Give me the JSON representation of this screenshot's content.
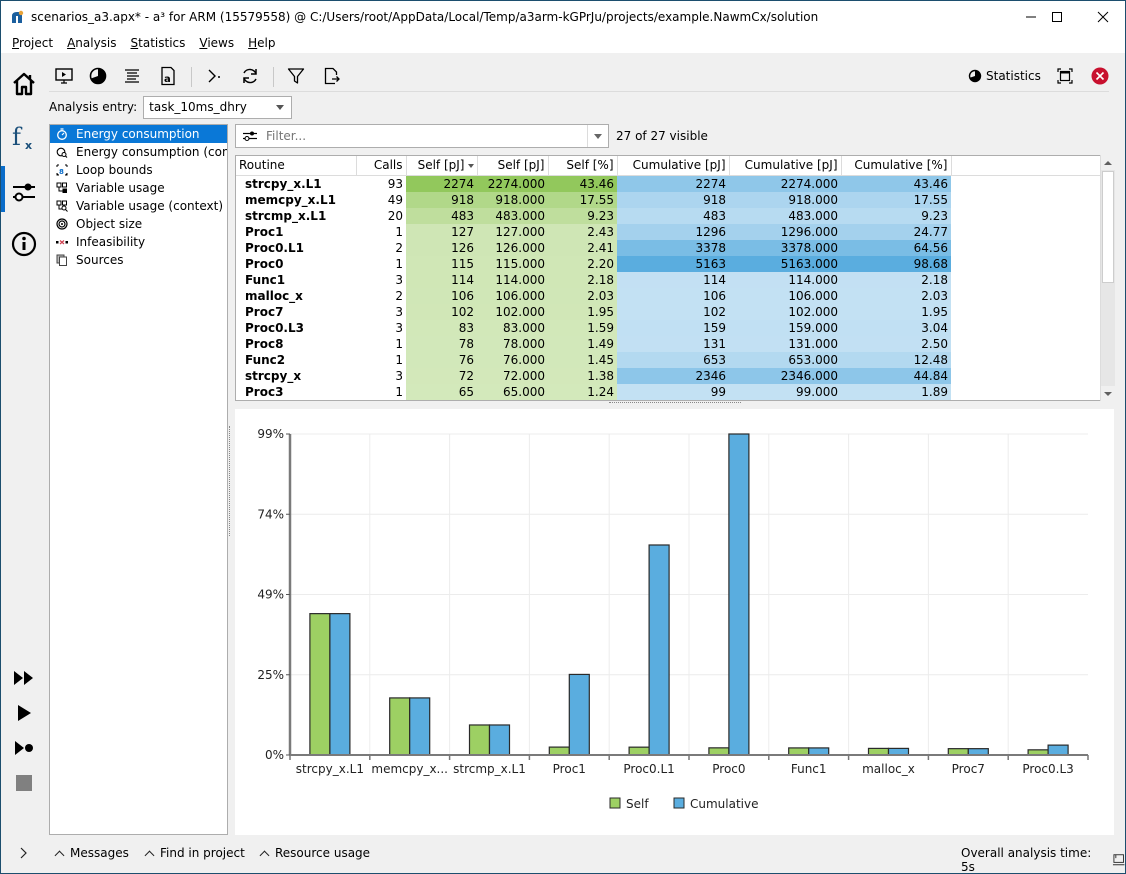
{
  "window": {
    "title": "scenarios_a3.apx* - a³ for ARM (15579558) @ C:/Users/root/AppData/Local/Temp/a3arm-kGPrJu/projects/example.NawmCx/solution",
    "controls": [
      "minimize",
      "maximize",
      "close"
    ]
  },
  "menu": [
    {
      "label": "Project",
      "accel": "P"
    },
    {
      "label": "Analysis",
      "accel": "A"
    },
    {
      "label": "Statistics",
      "accel": "S"
    },
    {
      "label": "Views",
      "accel": "V"
    },
    {
      "label": "Help",
      "accel": "H"
    }
  ],
  "left_rail": {
    "top_icons": [
      "home-icon",
      "function-icon",
      "settings-slider-icon",
      "info-icon"
    ],
    "active": "function-icon",
    "bottom_icons": [
      "run-all-icon",
      "run-icon",
      "run-to-breakpoint-icon",
      "stop-icon"
    ]
  },
  "toolbar": {
    "buttons": [
      "presentation-icon",
      "pie-chart-icon",
      "text-align-icon",
      "text-file-icon",
      "step-icon",
      "refresh-icon",
      "filter-icon",
      "export-icon"
    ],
    "statistics_label": "Statistics"
  },
  "analysis_entry": {
    "label": "Analysis entry:",
    "value": "task_10ms_dhry"
  },
  "nav": {
    "items": [
      {
        "label": "Energy consumption",
        "icon": "stopwatch-icon",
        "selected": true
      },
      {
        "label": "Energy consumption (con...",
        "icon": "stopwatch-search-icon",
        "selected": false
      },
      {
        "label": "Loop bounds",
        "icon": "loop-bounds-icon",
        "selected": false
      },
      {
        "label": "Variable usage",
        "icon": "variable-usage-icon",
        "selected": false
      },
      {
        "label": "Variable usage (context)",
        "icon": "variable-usage-context-icon",
        "selected": false
      },
      {
        "label": "Object size",
        "icon": "object-size-icon",
        "selected": false
      },
      {
        "label": "Infeasibility",
        "icon": "infeasibility-icon",
        "selected": false
      },
      {
        "label": "Sources",
        "icon": "sources-icon",
        "selected": false
      }
    ]
  },
  "filter": {
    "placeholder": "Filter...",
    "value": "",
    "visible_text": "27 of 27 visible"
  },
  "table": {
    "columns": [
      "Routine",
      "Calls",
      "Self [pJ]",
      "Self [pJ]",
      "Self [%]",
      "Cumulative [pJ]",
      "Cumulative [pJ]",
      "Cumulative [%]"
    ],
    "sorted_column": 2,
    "rows": [
      [
        "strcpy_x.L1",
        "93",
        "2274",
        "2274.000",
        "43.46",
        "2274",
        "2274.000",
        "43.46"
      ],
      [
        "memcpy_x.L1",
        "49",
        "918",
        "918.000",
        "17.55",
        "918",
        "918.000",
        "17.55"
      ],
      [
        "strcmp_x.L1",
        "20",
        "483",
        "483.000",
        "9.23",
        "483",
        "483.000",
        "9.23"
      ],
      [
        "Proc1",
        "1",
        "127",
        "127.000",
        "2.43",
        "1296",
        "1296.000",
        "24.77"
      ],
      [
        "Proc0.L1",
        "2",
        "126",
        "126.000",
        "2.41",
        "3378",
        "3378.000",
        "64.56"
      ],
      [
        "Proc0",
        "1",
        "115",
        "115.000",
        "2.20",
        "5163",
        "5163.000",
        "98.68"
      ],
      [
        "Func1",
        "3",
        "114",
        "114.000",
        "2.18",
        "114",
        "114.000",
        "2.18"
      ],
      [
        "malloc_x",
        "2",
        "106",
        "106.000",
        "2.03",
        "106",
        "106.000",
        "2.03"
      ],
      [
        "Proc7",
        "3",
        "102",
        "102.000",
        "1.95",
        "102",
        "102.000",
        "1.95"
      ],
      [
        "Proc0.L3",
        "3",
        "83",
        "83.000",
        "1.59",
        "159",
        "159.000",
        "3.04"
      ],
      [
        "Proc8",
        "1",
        "78",
        "78.000",
        "1.49",
        "131",
        "131.000",
        "2.50"
      ],
      [
        "Func2",
        "1",
        "76",
        "76.000",
        "1.45",
        "653",
        "653.000",
        "12.48"
      ],
      [
        "strcpy_x",
        "3",
        "72",
        "72.000",
        "1.38",
        "2346",
        "2346.000",
        "44.84"
      ],
      [
        "Proc3",
        "1",
        "65",
        "65.000",
        "1.24",
        "99",
        "99.000",
        "1.89"
      ]
    ],
    "colors": {
      "self_max": "#92c85c",
      "self_min": "#dcedc8",
      "cum_max": "#5aaddf",
      "cum_min": "#c8e3f4"
    }
  },
  "chart_data": {
    "type": "bar",
    "title": "",
    "xlabel": "",
    "ylabel": "",
    "categories": [
      "strcpy_x.L1",
      "memcpy_x...",
      "strcmp_x.L1",
      "Proc1",
      "Proc0.L1",
      "Proc0",
      "Func1",
      "malloc_x",
      "Proc7",
      "Proc0.L3"
    ],
    "series": [
      {
        "name": "Self",
        "color": "#9dd063",
        "values": [
          43.46,
          17.55,
          9.23,
          2.43,
          2.41,
          2.2,
          2.18,
          2.03,
          1.95,
          1.59
        ]
      },
      {
        "name": "Cumulative",
        "color": "#5aaddf",
        "values": [
          43.46,
          17.55,
          9.23,
          24.77,
          64.56,
          98.68,
          2.18,
          2.03,
          1.95,
          3.04
        ]
      }
    ],
    "ylim": [
      0,
      98.68
    ],
    "yticks": [
      "0%",
      "25%",
      "49%",
      "74%",
      "99%"
    ],
    "ytick_values": [
      0,
      24.67,
      49.34,
      74.01,
      98.68
    ],
    "grid": true,
    "legend": "bottom-center"
  },
  "bottom_bar": {
    "expand_label": ">",
    "tabs": [
      "Messages",
      "Find in project",
      "Resource usage"
    ],
    "status": "Overall analysis time: 5s"
  }
}
